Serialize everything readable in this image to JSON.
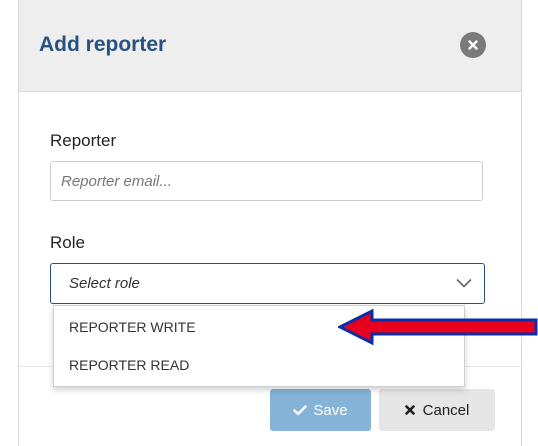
{
  "dialog": {
    "title": "Add reporter",
    "reporter_label": "Reporter",
    "email_placeholder": "Reporter email...",
    "role_label": "Role",
    "role_select_value": "Select role",
    "role_options": [
      "REPORTER WRITE",
      "REPORTER READ"
    ],
    "save_label": "Save",
    "cancel_label": "Cancel"
  },
  "icons": {
    "close": "close-icon",
    "chevron": "chevron-down-icon",
    "save": "check-icon",
    "cancel": "x-icon",
    "pointer": "red-arrow-icon"
  },
  "colors": {
    "title": "#27527f",
    "save_button": "#85b4d8",
    "cancel_button": "#e6e6e6",
    "arrow": "#e8001c"
  }
}
